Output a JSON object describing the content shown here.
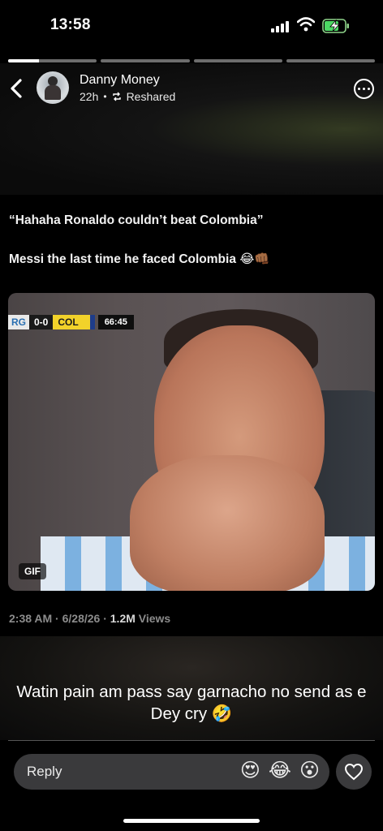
{
  "status_bar": {
    "time": "13:58"
  },
  "story": {
    "segments": 4,
    "active_segment": 1,
    "active_progress": 0.35
  },
  "header": {
    "username": "Danny Money",
    "age": "22h",
    "separator": "•",
    "reshared_label": "Reshared"
  },
  "tweet": {
    "line1": "“Hahaha Ronaldo couldn’t beat Colombia”",
    "line2": "Messi the last time he faced Colombia 😂👊🏾"
  },
  "media": {
    "badge": "GIF",
    "scoreboard": {
      "team1": "RG",
      "score": "0-0",
      "team2": "COL",
      "clock": "66:45"
    }
  },
  "post_meta": {
    "time_date": "2:38 AM · 6/28/26 · ",
    "views_count": "1.2M",
    "views_label": " Views"
  },
  "caption": "Watin pain am pass say garnacho no send as e Dey cry 🤣",
  "reply_bar": {
    "placeholder": "Reply",
    "quick_reactions": [
      "😍",
      "😂",
      "😮"
    ]
  },
  "colors": {
    "background": "#000000",
    "reply_bg": "#3a3a3c",
    "meta_gray": "#8c8c8c"
  }
}
